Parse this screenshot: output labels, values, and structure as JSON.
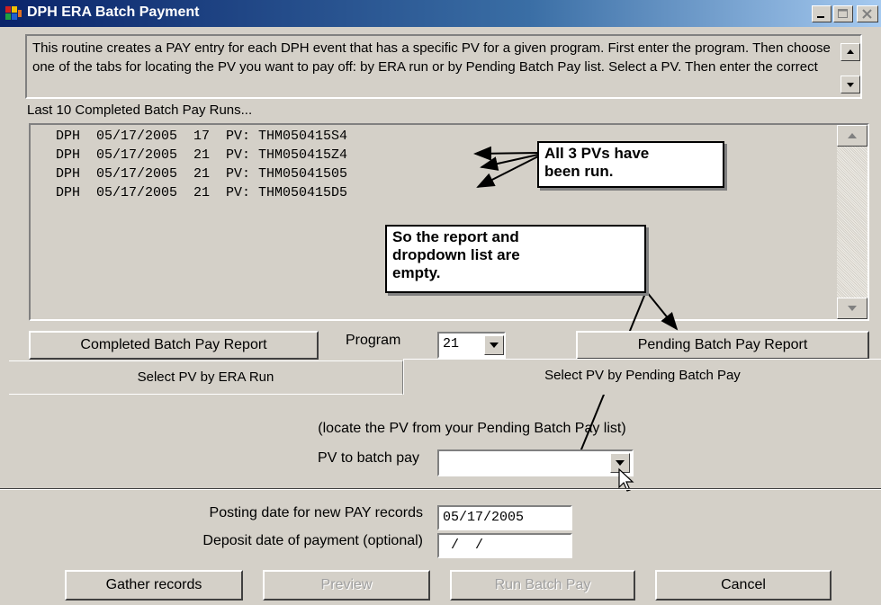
{
  "window": {
    "title": "DPH ERA Batch Payment"
  },
  "intro": {
    "text": "This routine creates a PAY entry for each DPH event that has a specific PV for a given program.  First enter the program.  Then choose one of the tabs for locating the PV you want to pay off: by ERA run or by Pending Batch Pay list. Select a PV. Then enter the correct"
  },
  "runs": {
    "label": "Last 10 Completed Batch Pay Runs...",
    "rows": [
      "DPH  05/17/2005  17  PV: THM050415S4",
      "DPH  05/17/2005  21  PV: THM050415Z4",
      "DPH  05/17/2005  21  PV: THM05041505",
      "DPH  05/17/2005  21  PV: THM050415D5"
    ]
  },
  "callouts": {
    "runs_note": [
      "All 3 PVs have",
      "been run."
    ],
    "empty_note": [
      "So the report and",
      "dropdown list are",
      "empty."
    ]
  },
  "buttons": {
    "completed_report": "Completed Batch Pay Report",
    "pending_report": "Pending Batch Pay Report",
    "gather": "Gather records",
    "preview": "Preview",
    "run_batch": "Run Batch Pay",
    "cancel": "Cancel"
  },
  "program": {
    "label": "Program",
    "value": "21"
  },
  "tabs": [
    {
      "label": "Select PV by ERA Run",
      "active": false
    },
    {
      "label": "Select PV by Pending Batch Pay",
      "active": true
    }
  ],
  "pending_panel": {
    "hint": "(locate the PV from your Pending Batch Pay list)",
    "pv_label": "PV to batch pay",
    "pv_value": ""
  },
  "dates": {
    "posting_label": "Posting date for new PAY records",
    "posting_value": "05/17/2005",
    "deposit_label": "Deposit date of payment (optional)",
    "deposit_value": " /  /"
  }
}
